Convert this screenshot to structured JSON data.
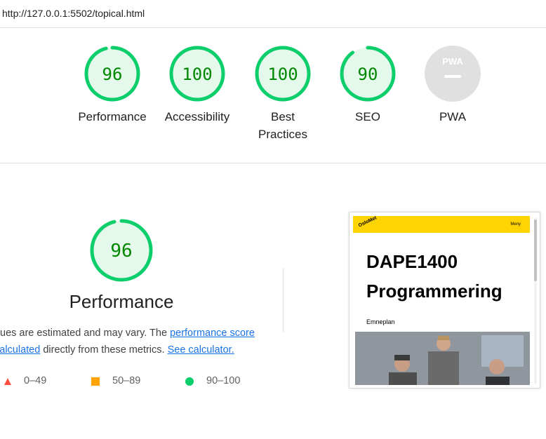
{
  "address_bar": {
    "url": "http://127.0.0.1:5502/topical.html"
  },
  "summary_gauges": [
    {
      "label": "Performance",
      "score": "96",
      "fraction": 0.96,
      "color": "#0cce6b"
    },
    {
      "label": "Accessibility",
      "score": "100",
      "fraction": 1.0,
      "color": "#0cce6b"
    },
    {
      "label": "Best Practices",
      "score": "100",
      "fraction": 1.0,
      "color": "#0cce6b"
    },
    {
      "label": "SEO",
      "score": "90",
      "fraction": 0.9,
      "color": "#0cce6b"
    },
    {
      "label": "PWA",
      "badge": "PWA",
      "color": "#e0e0e0"
    }
  ],
  "performance": {
    "score": "96",
    "fraction": 0.96,
    "title": "Performance",
    "desc_prefix": "ues are estimated and may vary. The ",
    "desc_link1": "performance score",
    "desc_link2": " calculated",
    "desc_middle": " directly from these metrics. ",
    "desc_link3": "See calculator."
  },
  "legend": [
    {
      "range": "0–49",
      "shape": "triangle",
      "color": "#ff4e42"
    },
    {
      "range": "50–89",
      "shape": "square",
      "color": "#ffa400"
    },
    {
      "range": "90–100",
      "shape": "circle",
      "color": "#0cce6b"
    }
  ],
  "screenshot": {
    "brand": "OsloMet",
    "menu_label": "Meny",
    "heading_line1": "DAPE1400",
    "heading_line2": "Programmering",
    "subtitle": "Emneplan",
    "bar_color": "#ffd400"
  },
  "colors": {
    "pass": "#0cce6b",
    "pass_text": "#008800",
    "pass_fill": "#e5f8ec",
    "link": "#1a73e8"
  }
}
